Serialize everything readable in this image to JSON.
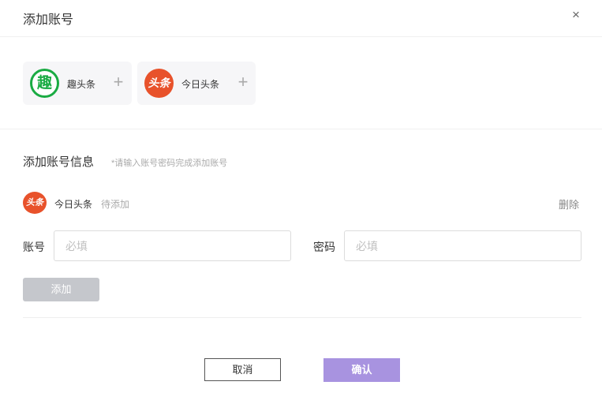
{
  "dialog": {
    "title": "添加账号",
    "close_glyph": "×"
  },
  "platforms": [
    {
      "name": "趣头条",
      "logo_text": "趣",
      "icon": "qutoutiao-logo-icon",
      "add_glyph": "+"
    },
    {
      "name": "今日头条",
      "logo_text": "头条",
      "icon": "toutiao-logo-icon",
      "add_glyph": "+"
    }
  ],
  "account_info": {
    "title": "添加账号信息",
    "hint": "*请输入账号密码完成添加账号",
    "platform_logo_text": "头条",
    "platform_name": "今日头条",
    "status": "待添加",
    "delete_label": "删除"
  },
  "form": {
    "account_label": "账号",
    "account_placeholder": "必填",
    "account_value": "",
    "password_label": "密码",
    "password_placeholder": "必填",
    "password_value": "",
    "add_button": "添加"
  },
  "footer": {
    "cancel": "取消",
    "confirm": "确认"
  },
  "colors": {
    "qutoutiao_green": "#1aab43",
    "toutiao_red": "#e8522b",
    "confirm_purple": "#a893e0",
    "disabled_gray": "#c5c7cc"
  }
}
